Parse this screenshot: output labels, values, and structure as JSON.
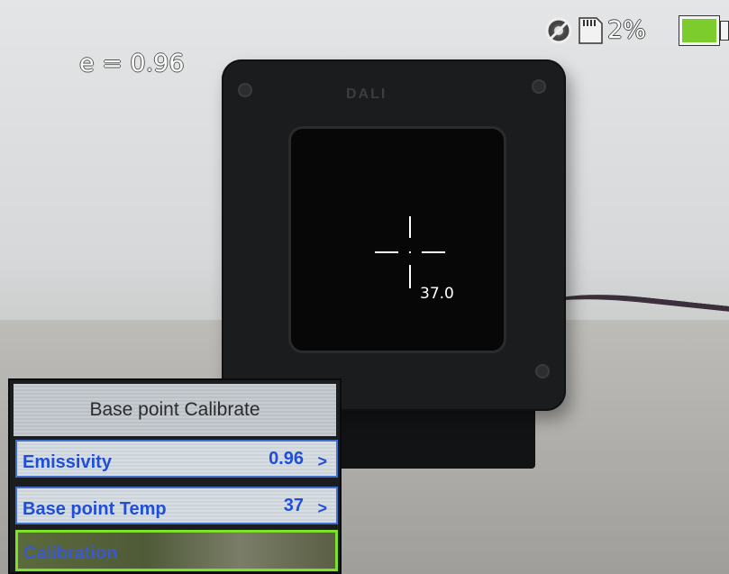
{
  "overlay": {
    "emissivity_text": "e = 0.96",
    "storage_text": "2%",
    "crosshair_temp": "37.0"
  },
  "status": {
    "gear_icon": "gear-icon",
    "sd_icon": "sd-card-icon",
    "battery_icon": "battery-icon",
    "battery_color": "#7ccc2e"
  },
  "scene": {
    "device_logo": "DALI"
  },
  "menu": {
    "title": "Base point Calibrate",
    "items": [
      {
        "label": "Emissivity",
        "value": "0.96",
        "chevron": ">"
      },
      {
        "label": "Base point Temp",
        "value": "37",
        "chevron": ">"
      },
      {
        "label": "Calibration",
        "value": "",
        "chevron": ""
      }
    ],
    "accent_color": "#1f4fd8",
    "selected_border_color": "#7fe02a"
  }
}
